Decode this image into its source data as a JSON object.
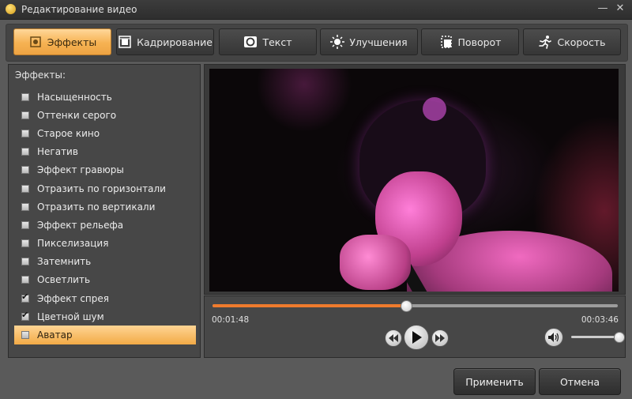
{
  "window": {
    "title": "Редактирование видео"
  },
  "tabs": [
    {
      "label": "Эффекты",
      "icon": "effects-icon",
      "active": true
    },
    {
      "label": "Кадрирование",
      "icon": "crop-film-icon",
      "active": false
    },
    {
      "label": "Текст",
      "icon": "text-icon",
      "active": false
    },
    {
      "label": "Улучшения",
      "icon": "brightness-icon",
      "active": false
    },
    {
      "label": "Поворот",
      "icon": "rotate-icon",
      "active": false
    },
    {
      "label": "Скорость",
      "icon": "running-man-icon",
      "active": false
    }
  ],
  "effects": {
    "heading": "Эффекты:",
    "items": [
      {
        "label": "Насыщенность",
        "checked": false
      },
      {
        "label": "Оттенки серого",
        "checked": false
      },
      {
        "label": "Старое кино",
        "checked": false
      },
      {
        "label": "Негатив",
        "checked": false
      },
      {
        "label": "Эффект гравюры",
        "checked": false
      },
      {
        "label": "Отразить по горизонтали",
        "checked": false
      },
      {
        "label": "Отразить по вертикали",
        "checked": false
      },
      {
        "label": "Эффект рельефа",
        "checked": false
      },
      {
        "label": "Пикселизация",
        "checked": false
      },
      {
        "label": "Затемнить",
        "checked": false
      },
      {
        "label": "Осветлить",
        "checked": false
      },
      {
        "label": "Эффект спрея",
        "checked": true
      },
      {
        "label": "Цветной шум",
        "checked": true
      },
      {
        "label": "Аватар",
        "checked": false,
        "selected": true
      }
    ]
  },
  "player": {
    "current_time": "00:01:48",
    "total_time": "00:03:46",
    "progress": 0.478,
    "volume": 1.0
  },
  "buttons": {
    "apply": "Применить",
    "cancel": "Отмена"
  },
  "colors": {
    "accent": "#ef7b2d",
    "selected_bg": "#f6b252"
  }
}
